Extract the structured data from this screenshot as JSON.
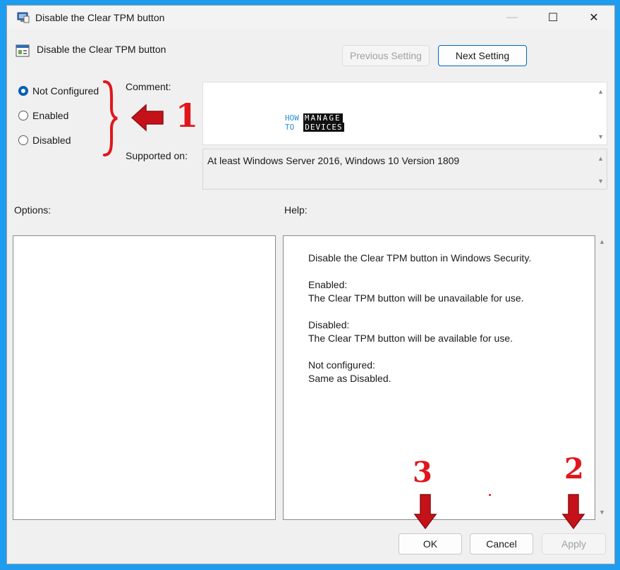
{
  "window": {
    "title": "Disable the Clear TPM button",
    "controls": {
      "minimize": "—",
      "maximize": "☐",
      "close": "✕"
    }
  },
  "policy": {
    "title": "Disable the Clear TPM button"
  },
  "nav": {
    "previous": "Previous Setting",
    "next": "Next Setting"
  },
  "state": {
    "options": [
      {
        "label": "Not Configured",
        "checked": true
      },
      {
        "label": "Enabled",
        "checked": false
      },
      {
        "label": "Disabled",
        "checked": false
      }
    ]
  },
  "comment": {
    "label": "Comment:",
    "watermark_line1_left": "HOW",
    "watermark_line1_right": "MANAGE",
    "watermark_line2_left": "TO",
    "watermark_line2_right": "DEVICES"
  },
  "supported": {
    "label": "Supported on:",
    "value": "At least Windows Server 2016, Windows 10 Version 1809"
  },
  "options_label": "Options:",
  "help": {
    "label": "Help:",
    "text": "Disable the Clear TPM button in Windows Security.\n\nEnabled:\nThe Clear TPM button will be unavailable for use.\n\nDisabled:\nThe Clear TPM button will be available for use.\n\nNot configured:\nSame as Disabled."
  },
  "footer": {
    "ok": "OK",
    "cancel": "Cancel",
    "apply": "Apply"
  },
  "annotations": {
    "step1": "1",
    "step2": "2",
    "step3": "3",
    "color": "#e0161d"
  }
}
